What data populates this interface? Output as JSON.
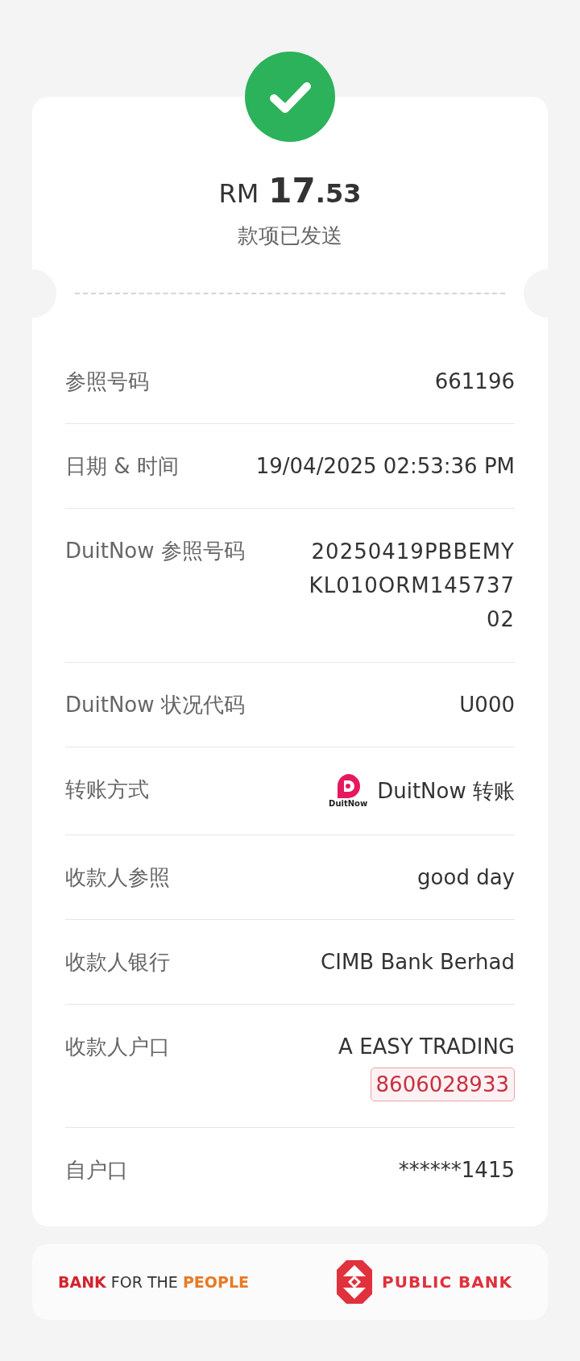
{
  "header": {
    "currency": "RM",
    "amount_whole": "17",
    "amount_decimal": ".53",
    "status": "款项已发送"
  },
  "rows": [
    {
      "kind": "text",
      "label": "参照号码",
      "value": "661196"
    },
    {
      "kind": "text",
      "label": "日期 & 时间",
      "value": "19/04/2025 02:53:36 PM"
    },
    {
      "kind": "wrapped",
      "label": "DuitNow 参照号码",
      "value": "20250419PBBEMYKL010ORM14573702"
    },
    {
      "kind": "text",
      "label": "DuitNow 状况代码",
      "value": "U000"
    },
    {
      "kind": "method",
      "label": "转账方式",
      "icon_caption": "DuitNow",
      "value": "DuitNow 转账"
    },
    {
      "kind": "text",
      "label": "收款人参照",
      "value": "good day"
    },
    {
      "kind": "text",
      "label": "收款人银行",
      "value": "CIMB Bank Berhad"
    },
    {
      "kind": "account",
      "label": "收款人户口",
      "value": "A EASY TRADING",
      "account_number": "8606028933"
    },
    {
      "kind": "text",
      "label": "自户口",
      "value": "******1415"
    }
  ],
  "footer": {
    "tagline": "**BANK** FOR THE **PEOPLE**",
    "bank_name": "PUBLIC BANK"
  }
}
